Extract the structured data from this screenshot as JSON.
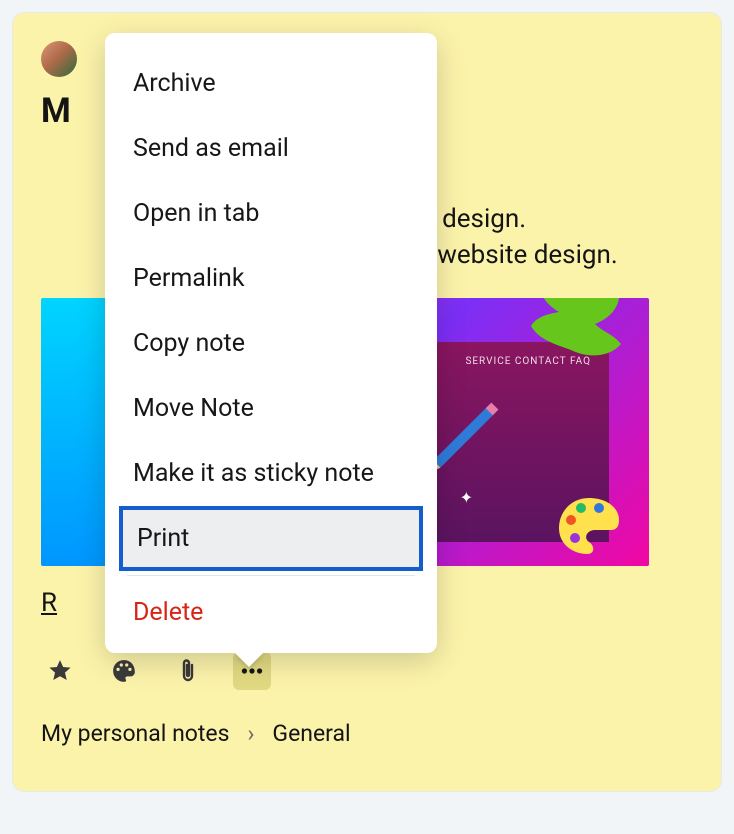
{
  "note": {
    "title_visible_fragment": "M",
    "body_line1_visible": "bsite design.",
    "body_line2_visible": "r the website design.",
    "link_visible_fragment": "R",
    "screen_nav": "SERVICE   CONTACT   FAQ"
  },
  "breadcrumb": {
    "root": "My personal notes",
    "current": "General"
  },
  "menu": {
    "items": [
      "Archive",
      "Send as email",
      "Open in tab",
      "Permalink",
      "Copy note",
      "Move Note",
      "Make it as sticky note",
      "Print"
    ],
    "highlighted": "Print",
    "delete": "Delete"
  }
}
